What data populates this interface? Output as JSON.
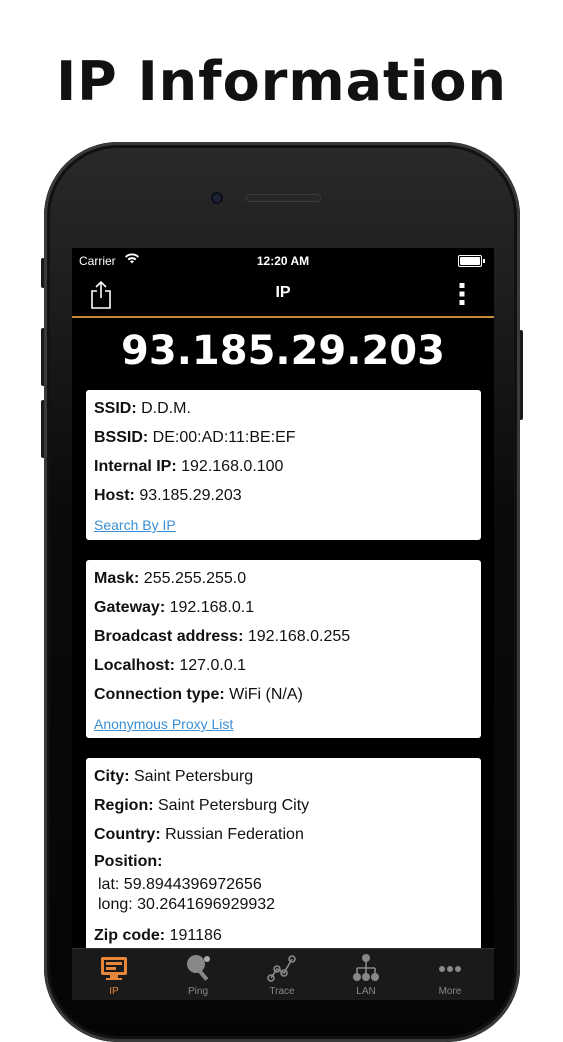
{
  "headline": "IP Information",
  "status": {
    "carrier": "Carrier",
    "time": "12:20 AM"
  },
  "navbar": {
    "title": "IP"
  },
  "ip_address": "93.185.29.203",
  "card1": {
    "ssid_label": "SSID:",
    "ssid_value": " D.D.M.",
    "bssid_label": "BSSID:",
    "bssid_value": " DE:00:AD:11:BE:EF",
    "internal_label": "Internal IP:",
    "internal_value": " 192.168.0.100",
    "host_label": "Host:",
    "host_value": " 93.185.29.203",
    "link": "Search By IP"
  },
  "card2": {
    "mask_label": "Mask:",
    "mask_value": " 255.255.255.0",
    "gateway_label": "Gateway:",
    "gateway_value": " 192.168.0.1",
    "broadcast_label": "Broadcast address:",
    "broadcast_value": " 192.168.0.255",
    "localhost_label": "Localhost:",
    "localhost_value": " 127.0.0.1",
    "conn_label": "Connection type:",
    "conn_value": " WiFi (N/A)",
    "link": "Anonymous Proxy List"
  },
  "card3": {
    "city_label": "City:",
    "city_value": " Saint Petersburg",
    "region_label": "Region:",
    "region_value": " Saint Petersburg City",
    "country_label": "Country:",
    "country_value": " Russian Federation",
    "position_label": "Position:",
    "lat": "lat: 59.8944396972656",
    "long": "long: 30.2641696929932",
    "zip_label": "Zip code:",
    "zip_value": " 191186"
  },
  "tabs": [
    {
      "label": "IP",
      "icon": "monitor-icon",
      "active": true
    },
    {
      "label": "Ping",
      "icon": "ping-pong-icon",
      "active": false
    },
    {
      "label": "Trace",
      "icon": "trace-route-icon",
      "active": false
    },
    {
      "label": "LAN",
      "icon": "lan-network-icon",
      "active": false
    },
    {
      "label": "More",
      "icon": "more-dots-icon",
      "active": false
    }
  ],
  "colors": {
    "accent": "#e8873a",
    "link": "#3a8fd6",
    "divider": "#c9893a"
  }
}
